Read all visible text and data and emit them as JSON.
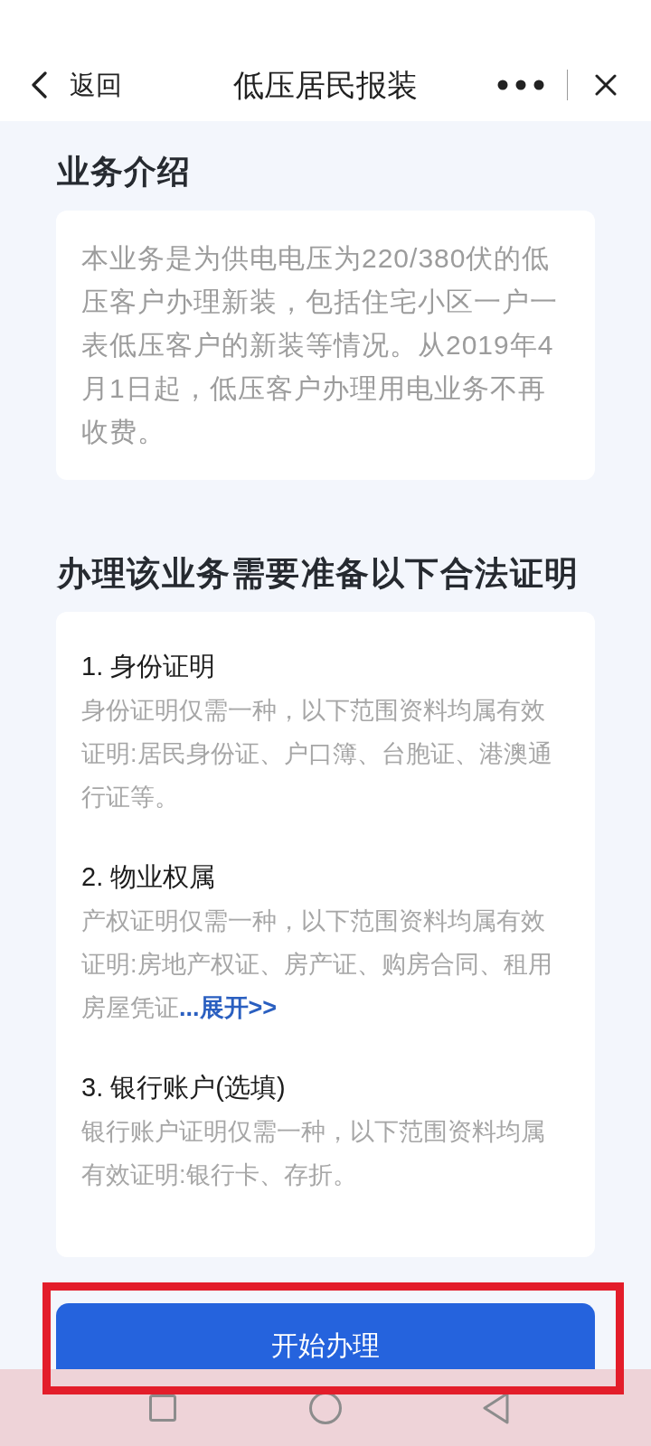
{
  "header": {
    "back_label": "返回",
    "title": "低压居民报装"
  },
  "intro": {
    "heading": "业务介绍",
    "text": "本业务是为供电电压为220/380伏的低压客户办理新装，包括住宅小区一户一表低压客户的新装等情况。从2019年4月1日起，低压客户办理用电业务不再收费。"
  },
  "requirements": {
    "heading": "办理该业务需要准备以下合法证明",
    "items": [
      {
        "title": "1. 身份证明",
        "description": "身份证明仅需一种，以下范围资料均属有效证明:居民身份证、户口簿、台胞证、港澳通行证等。"
      },
      {
        "title": "2. 物业权属",
        "description": "产权证明仅需一种，以下范围资料均属有效证明:房地产权证、房产证、购房合同、租用房屋凭证",
        "more_link": "...展开>>"
      },
      {
        "title": "3. 银行账户(选填)",
        "description": "银行账户证明仅需一种，以下范围资料均属有效证明:银行卡、存折。"
      }
    ]
  },
  "start_button": {
    "label": "开始办理",
    "highlighted": true
  }
}
